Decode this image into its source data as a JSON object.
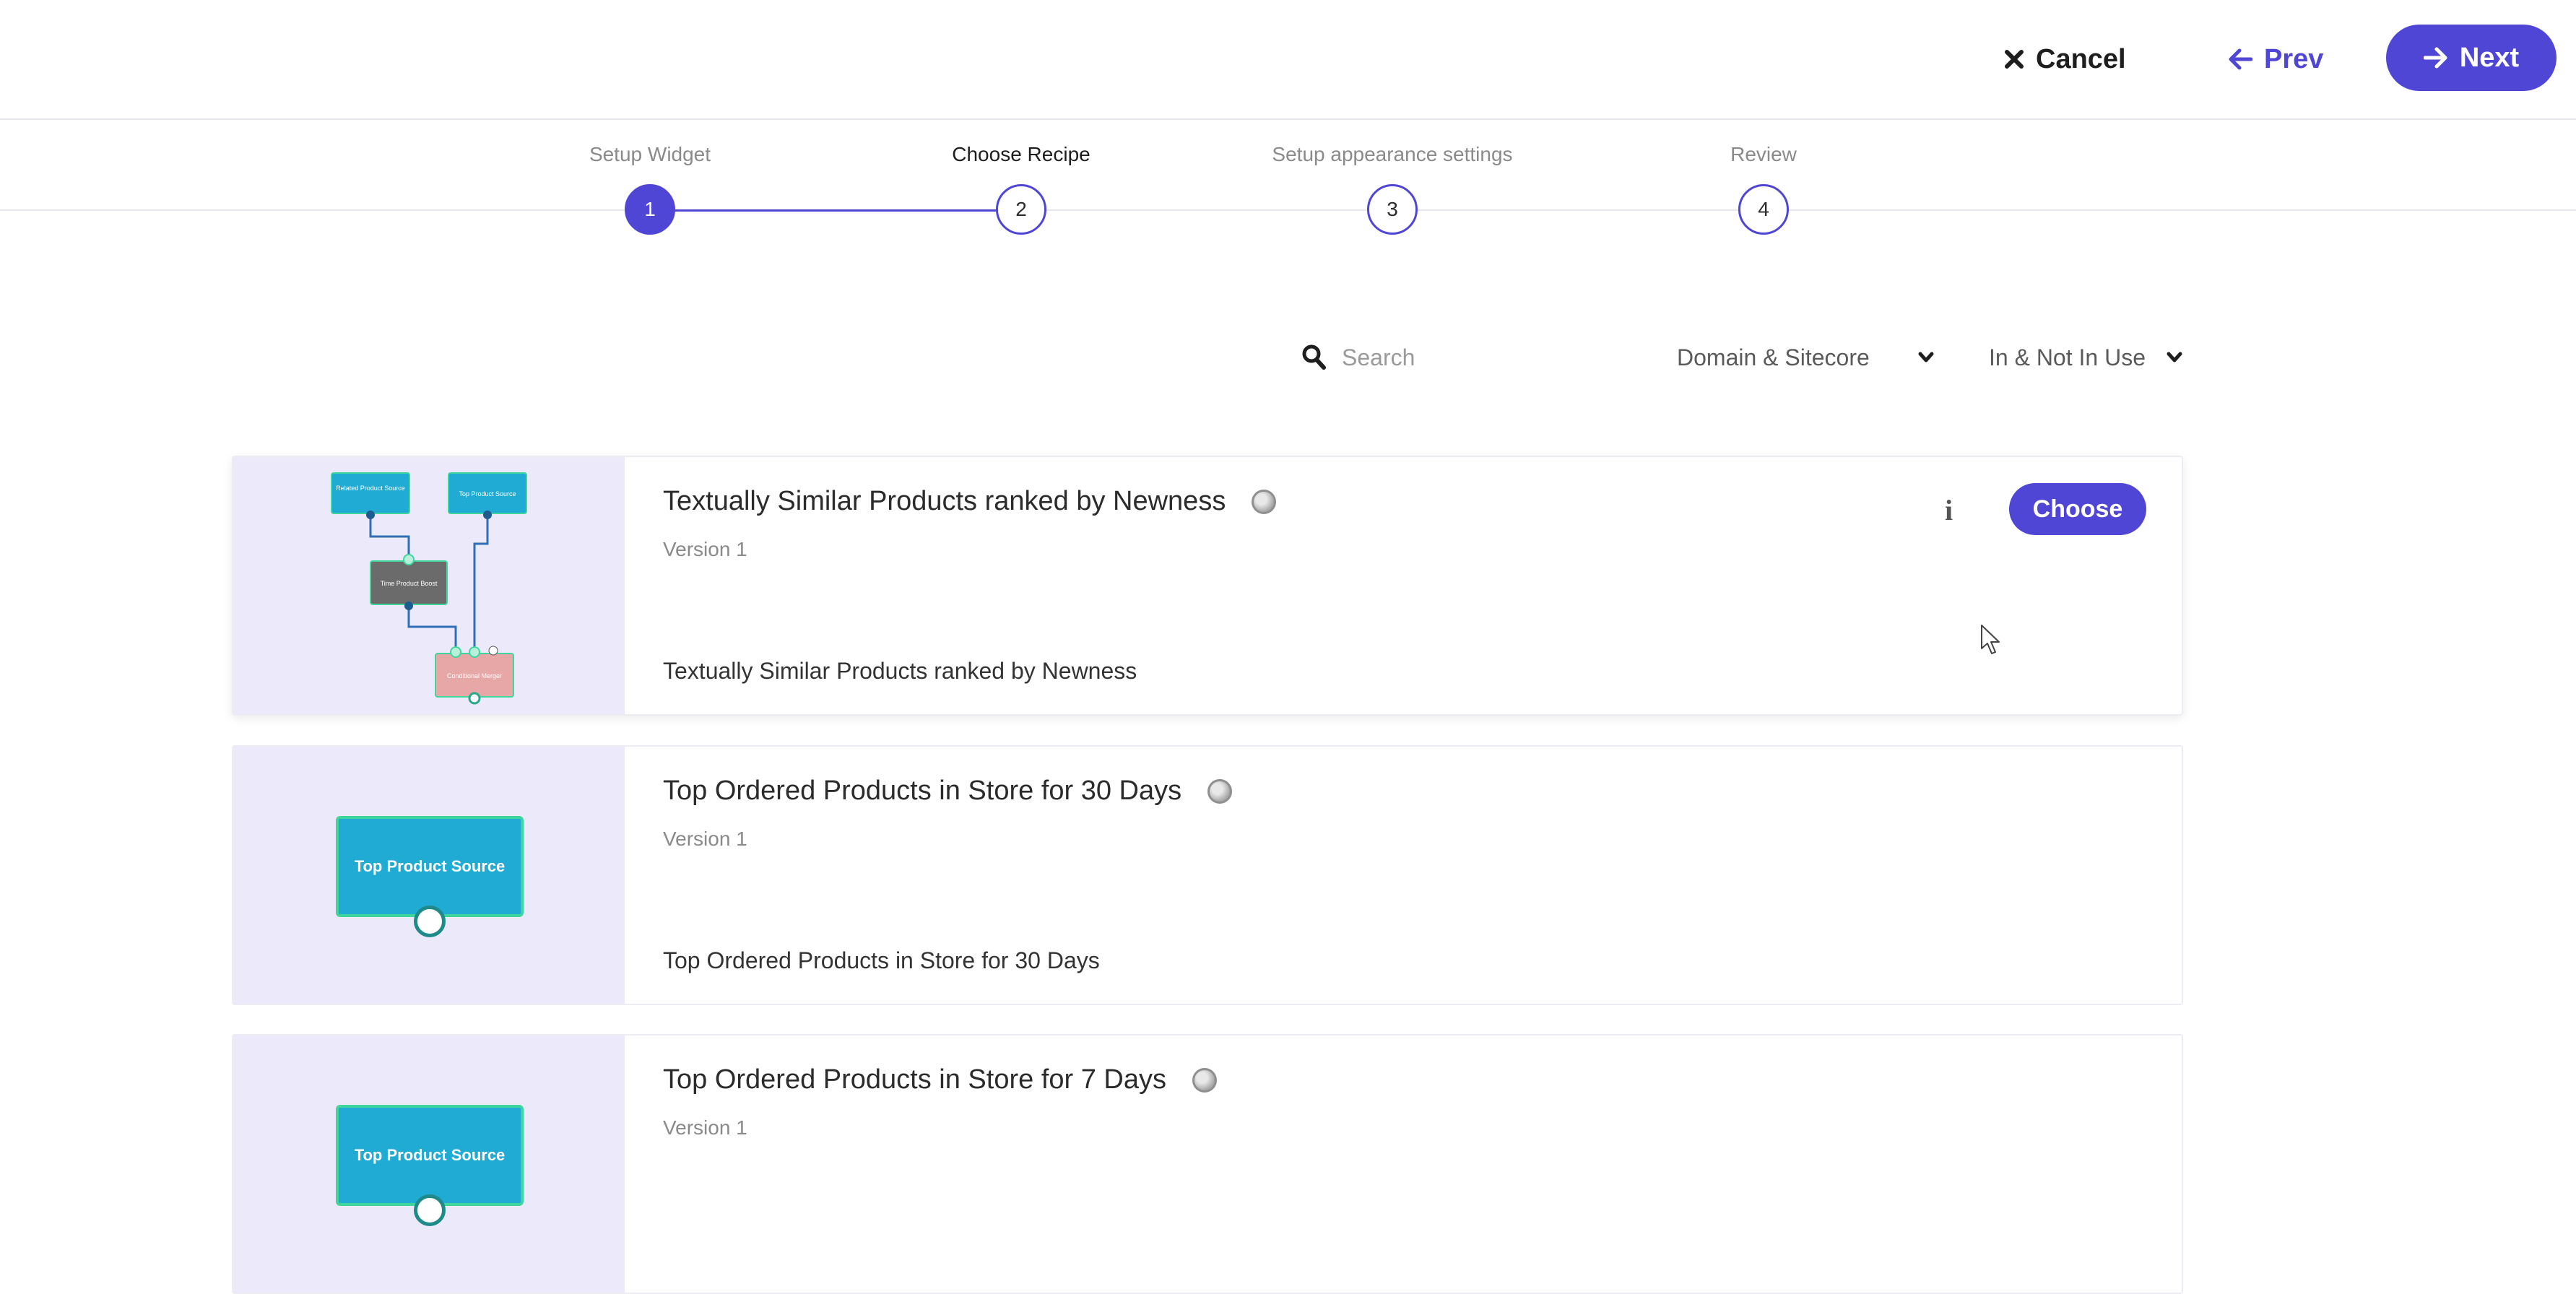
{
  "header": {
    "cancel_label": "Cancel",
    "prev_label": "Prev",
    "next_label": "Next"
  },
  "stepper": {
    "steps": [
      {
        "label": "Setup Widget",
        "number": "1"
      },
      {
        "label": "Choose Recipe",
        "number": "2"
      },
      {
        "label": "Setup appearance settings",
        "number": "3"
      },
      {
        "label": "Review",
        "number": "4"
      }
    ],
    "current_step": 2
  },
  "filters": {
    "search_placeholder": "Search",
    "search_value": "",
    "domain_selected": "Domain & Sitecore",
    "usage_selected": "In & Not In Use"
  },
  "recipes": [
    {
      "title": "Textually Similar Products ranked by Newness",
      "version": "Version 1",
      "description": "Textually Similar Products ranked by Newness",
      "choose_label": "Choose",
      "info_icon": "i",
      "thumb_nodes": [
        "Related Product Source",
        "Top Product Source",
        "Time Product Boost",
        "Conditional Merger"
      ]
    },
    {
      "title": "Top Ordered Products in Store for 30 Days",
      "version": "Version 1",
      "description": "Top Ordered Products in Store for 30 Days",
      "thumb_node": "Top Product Source"
    },
    {
      "title": "Top Ordered Products in Store for 7 Days",
      "version": "Version 1",
      "thumb_node": "Top Product Source"
    }
  ],
  "colors": {
    "accent": "#5046d6",
    "thumb_bg": "#ece9fa",
    "source_node": "#1fabd4",
    "node_border": "#3ed69c"
  }
}
